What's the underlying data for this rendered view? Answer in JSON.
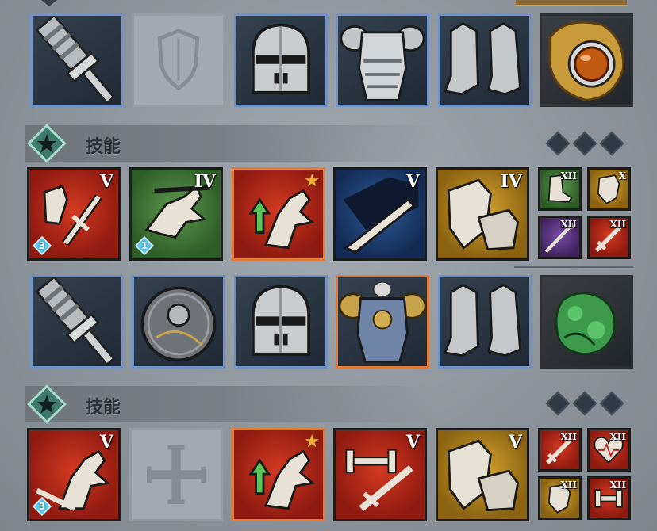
{
  "sections": [
    {
      "header": {
        "label": "技能",
        "icon": "star-emblem-icon"
      }
    },
    {
      "header": {
        "label": "技能",
        "icon": "star-emblem-icon"
      }
    }
  ],
  "loadout1": {
    "equipment": [
      "mace-icon",
      "empty-shield-slot-icon",
      "great-helm-icon",
      "plate-armor-icon",
      "plate-boots-icon",
      "golden-gem-amulet-icon"
    ],
    "skills": [
      {
        "icon": "broken-lance-icon",
        "color": "red",
        "rank": "V",
        "gem_count": "3"
      },
      {
        "icon": "horse-charge-icon",
        "color": "green",
        "rank": "IV",
        "gem_count": "1"
      },
      {
        "icon": "horse-buff-icon",
        "color": "red",
        "rank": "",
        "starred": true
      },
      {
        "icon": "spike-trap-icon",
        "color": "blue",
        "rank": "V"
      },
      {
        "icon": "shield-gauntlet-icon",
        "color": "gold",
        "rank": "IV"
      }
    ],
    "minor_skills": [
      {
        "icon": "boot-icon",
        "color": "green",
        "rank": "XII"
      },
      {
        "icon": "shield-icon",
        "color": "gold",
        "rank": "X"
      },
      {
        "icon": "spear-icon",
        "color": "purple",
        "rank": "XII"
      },
      {
        "icon": "sword-icon",
        "color": "red",
        "rank": "XII"
      }
    ]
  },
  "loadout2": {
    "equipment": [
      "mace-icon",
      "round-shield-icon",
      "great-helm-icon",
      "gold-plate-armor-icon",
      "plate-boots-icon",
      "jade-dragon-icon"
    ],
    "skills": [
      {
        "icon": "horse-sword-icon",
        "color": "red",
        "rank": "V",
        "gem_count": "3"
      },
      {
        "icon": "empty-cross-slot-icon",
        "color": "empty",
        "rank": ""
      },
      {
        "icon": "horse-buff-icon",
        "color": "red",
        "rank": "",
        "starred": true
      },
      {
        "icon": "dumbbell-sword-icon",
        "color": "red",
        "rank": "V"
      },
      {
        "icon": "shield-gauntlet-icon",
        "color": "gold",
        "rank": "V"
      }
    ],
    "minor_skills": [
      {
        "icon": "sword-icon",
        "color": "red",
        "rank": "XII"
      },
      {
        "icon": "heart-icon",
        "color": "red",
        "rank": "XII"
      },
      {
        "icon": "shield-icon",
        "color": "gold",
        "rank": "XII"
      },
      {
        "icon": "dumbbell-icon",
        "color": "red",
        "rank": "XII"
      }
    ]
  },
  "colors": {
    "equip_border": "#6f94c9",
    "legendary_border": "#e17b3a",
    "gem": "#5ec8e8",
    "star": "#f2b53b"
  }
}
